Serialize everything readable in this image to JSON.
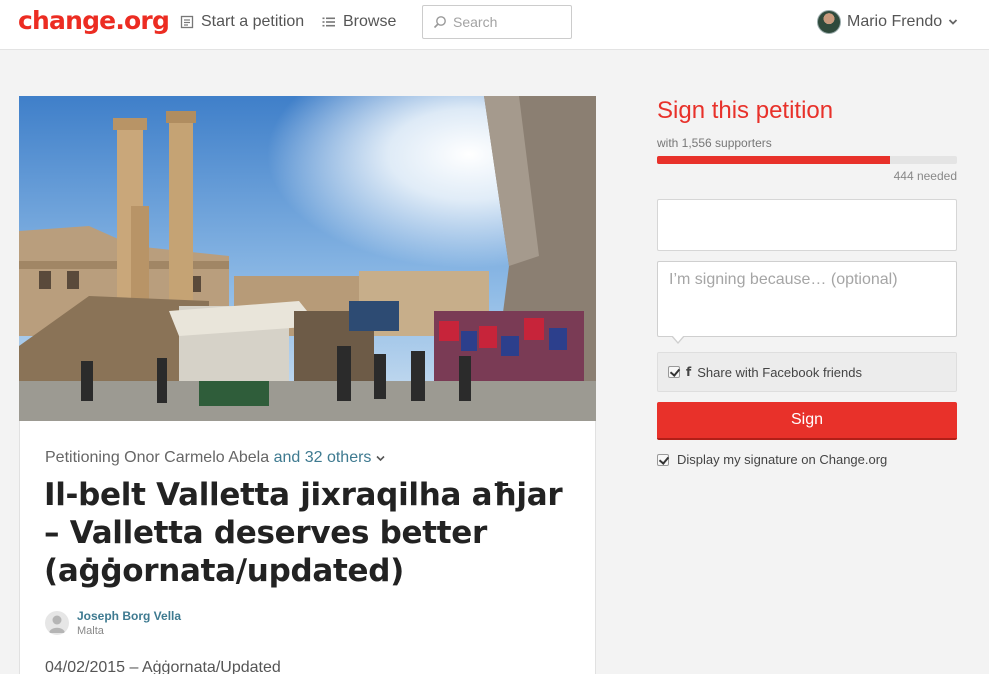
{
  "header": {
    "logo": "change.org",
    "start_label": "Start a petition",
    "browse_label": "Browse",
    "search_placeholder": "Search",
    "user_name": "Mario Frendo"
  },
  "petition": {
    "petitioning_prefix": "Petitioning Onor Carmelo Abela",
    "petitioning_others": "and 32 others",
    "title": "Il-belt Valletta jixraqilha aħjar – Valletta deserves better (aġġornata/updated)",
    "author_name": "Joseph Borg Vella",
    "author_location": "Malta",
    "update_line": "04/02/2015 – Aġġornata/Updated"
  },
  "sidebar": {
    "sign_title": "Sign this petition",
    "supporters": "with 1,556 supporters",
    "progress_fraction": 0.778,
    "needed": "444 needed",
    "reason_placeholder": "I’m signing because… (optional)",
    "share_facebook": "Share with Facebook friends",
    "sign_button": "Sign",
    "display_signature": "Display my signature on Change.org"
  },
  "colors": {
    "brand_red": "#ec2c22",
    "link_teal": "#3e7a90"
  }
}
